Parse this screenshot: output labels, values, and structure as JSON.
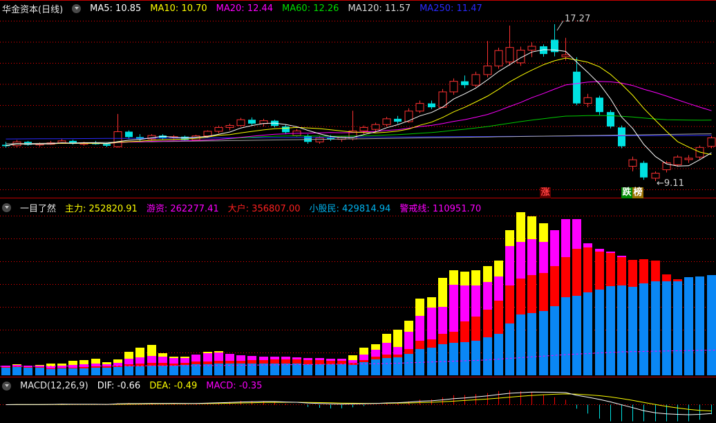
{
  "header": {
    "title": "华金资本(日线)",
    "ma_items": [
      {
        "name": "ma5-value",
        "label": "MA5:",
        "value": "10.85",
        "color": "#ffffff"
      },
      {
        "name": "ma10-value",
        "label": "MA10:",
        "value": "10.70",
        "color": "#ffff00"
      },
      {
        "name": "ma20-value",
        "label": "MA20:",
        "value": "12.44",
        "color": "#ff00ff"
      },
      {
        "name": "ma60-value",
        "label": "MA60:",
        "value": "12.26",
        "color": "#00dd00"
      },
      {
        "name": "ma120-value",
        "label": "MA120:",
        "value": "11.57",
        "color": "#d8d8d8"
      },
      {
        "name": "ma250-value",
        "label": "MA250:",
        "value": "11.47",
        "color": "#2a2aff"
      }
    ]
  },
  "middle_header": {
    "indicator": "一目了然",
    "items": [
      {
        "name": "zhuli-value",
        "label": "主力:",
        "value": "252820.91",
        "color": "#ffff00"
      },
      {
        "name": "youzi-value",
        "label": "游资:",
        "value": "262277.41",
        "color": "#ff00ff"
      },
      {
        "name": "dahu-value",
        "label": "大户:",
        "value": "356807.00",
        "color": "#ff2020"
      },
      {
        "name": "xiaogumin-value",
        "label": "小股民:",
        "value": "429814.94",
        "color": "#00b4f0"
      },
      {
        "name": "jingjiexian-value",
        "label": "警戒线:",
        "value": "110951.70",
        "color": "#ff00ff"
      }
    ]
  },
  "macd_header": {
    "indicator": "MACD(12,26,9)",
    "items": [
      {
        "name": "dif-value",
        "label": "DIF:",
        "value": "-0.66",
        "color": "#ffffff"
      },
      {
        "name": "dea-value",
        "label": "DEA:",
        "value": "-0.49",
        "color": "#ffff00"
      },
      {
        "name": "macd-value",
        "label": "MACD:",
        "value": "-0.35",
        "color": "#ff00ff"
      }
    ]
  },
  "annotations": {
    "high": "17.27",
    "low": "9.11",
    "zhang": "涨",
    "die": "跌",
    "bang": "榜"
  },
  "chart_data": [
    {
      "type": "candlestick",
      "title": "华金资本 日线",
      "ylim": [
        9.11,
        17.27
      ],
      "legend": [
        "MA5",
        "MA10",
        "MA20",
        "MA60",
        "MA120",
        "MA250"
      ],
      "ma_last": {
        "MA5": 10.85,
        "MA10": 10.7,
        "MA20": 12.44,
        "MA60": 12.26,
        "MA120": 11.57,
        "MA250": 11.47
      },
      "up_color": "#ff3232",
      "down_color": "#00e2e2",
      "grid": "red-dotted",
      "ohlc": [
        [
          11.0,
          11.15,
          10.85,
          10.95
        ],
        [
          10.95,
          11.25,
          10.88,
          11.15
        ],
        [
          11.15,
          11.2,
          10.95,
          11.0
        ],
        [
          11.0,
          11.12,
          10.9,
          11.06
        ],
        [
          11.06,
          11.2,
          11.0,
          11.1
        ],
        [
          11.1,
          11.3,
          11.05,
          11.2
        ],
        [
          11.2,
          11.26,
          11.0,
          11.05
        ],
        [
          11.05,
          11.16,
          10.95,
          11.1
        ],
        [
          11.1,
          11.2,
          11.0,
          11.04
        ],
        [
          11.04,
          11.1,
          10.88,
          10.95
        ],
        [
          10.9,
          12.6,
          10.85,
          11.68
        ],
        [
          11.68,
          11.75,
          11.3,
          11.4
        ],
        [
          11.4,
          11.55,
          11.2,
          11.3
        ],
        [
          11.3,
          11.55,
          11.25,
          11.48
        ],
        [
          11.48,
          11.55,
          11.28,
          11.35
        ],
        [
          11.35,
          11.5,
          11.25,
          11.42
        ],
        [
          11.42,
          11.48,
          11.18,
          11.25
        ],
        [
          11.25,
          11.52,
          11.2,
          11.46
        ],
        [
          11.46,
          11.75,
          11.35,
          11.7
        ],
        [
          11.7,
          12.0,
          11.6,
          11.9
        ],
        [
          11.9,
          12.1,
          11.75,
          12.0
        ],
        [
          12.0,
          12.4,
          11.95,
          12.3
        ],
        [
          12.3,
          12.42,
          12.02,
          12.1
        ],
        [
          12.1,
          12.35,
          11.95,
          12.25
        ],
        [
          12.25,
          12.3,
          11.9,
          11.98
        ],
        [
          11.95,
          12.05,
          11.55,
          11.65
        ],
        [
          11.48,
          11.82,
          11.42,
          11.72
        ],
        [
          11.45,
          11.55,
          11.05,
          11.15
        ],
        [
          11.15,
          11.45,
          11.05,
          11.35
        ],
        [
          11.35,
          11.5,
          11.2,
          11.28
        ],
        [
          11.28,
          11.45,
          11.15,
          11.4
        ],
        [
          11.3,
          12.77,
          11.22,
          11.72
        ],
        [
          11.72,
          12.0,
          11.55,
          11.9
        ],
        [
          11.8,
          12.15,
          11.7,
          12.05
        ],
        [
          12.05,
          12.45,
          11.95,
          12.35
        ],
        [
          12.35,
          12.5,
          12.1,
          12.2
        ],
        [
          12.2,
          12.9,
          12.15,
          12.75
        ],
        [
          12.75,
          13.3,
          12.65,
          13.15
        ],
        [
          13.15,
          13.3,
          12.85,
          12.95
        ],
        [
          12.95,
          13.9,
          12.9,
          13.75
        ],
        [
          13.75,
          14.45,
          13.6,
          14.3
        ],
        [
          14.3,
          14.6,
          13.95,
          14.1
        ],
        [
          14.1,
          14.8,
          14.0,
          14.65
        ],
        [
          14.65,
          16.4,
          14.5,
          15.1
        ],
        [
          15.1,
          16.05,
          14.95,
          15.9
        ],
        [
          15.3,
          17.2,
          15.12,
          16.06
        ],
        [
          15.26,
          16.1,
          15.1,
          15.92
        ],
        [
          15.92,
          16.32,
          15.56,
          16.12
        ],
        [
          16.12,
          16.22,
          15.58,
          15.72
        ],
        [
          16.46,
          17.27,
          15.6,
          15.82
        ],
        [
          15.58,
          16.56,
          15.38,
          15.68
        ],
        [
          14.8,
          15.55,
          13.05,
          13.15
        ],
        [
          13.15,
          13.65,
          12.95,
          13.45
        ],
        [
          13.45,
          13.55,
          12.55,
          12.7
        ],
        [
          12.7,
          12.8,
          11.85,
          11.95
        ],
        [
          11.9,
          12.0,
          10.82,
          10.92
        ],
        [
          9.88,
          10.38,
          9.62,
          10.22
        ],
        [
          10.06,
          10.16,
          9.18,
          9.3
        ],
        [
          9.26,
          9.62,
          9.11,
          9.52
        ],
        [
          9.7,
          10.16,
          9.56,
          10.06
        ],
        [
          9.96,
          10.46,
          9.86,
          10.36
        ],
        [
          10.26,
          10.46,
          10.06,
          10.3
        ],
        [
          10.36,
          10.96,
          10.26,
          10.86
        ],
        [
          10.92,
          11.46,
          10.82,
          11.36
        ]
      ]
    },
    {
      "type": "bar",
      "stacked": true,
      "name": "一目了然",
      "ylim": [
        0,
        760000
      ],
      "threshold_line": {
        "name": "警戒线",
        "value": 110951.7,
        "color": "#ff00ff"
      },
      "series": [
        {
          "name": "小股民",
          "color": "#0a87f5",
          "values": [
            33000,
            36000,
            33000,
            33000,
            27000,
            30000,
            30000,
            30000,
            33000,
            33000,
            36000,
            39000,
            39000,
            42000,
            42000,
            42000,
            45000,
            48000,
            48000,
            51000,
            51000,
            51000,
            51000,
            51000,
            51000,
            51000,
            51000,
            48000,
            48000,
            48000,
            48000,
            45000,
            57000,
            69000,
            75000,
            78000,
            93000,
            114000,
            120000,
            135000,
            141000,
            144000,
            150000,
            165000,
            180000,
            225000,
            264000,
            270000,
            279000,
            300000,
            339000,
            345000,
            360000,
            372000,
            387000,
            390000,
            384000,
            399000,
            408000,
            408000,
            408000,
            426000,
            429000,
            435000
          ]
        },
        {
          "name": "大户",
          "color": "#ff0000",
          "values": [
            3000,
            3000,
            3000,
            3000,
            3000,
            3000,
            3000,
            6000,
            6000,
            6000,
            6000,
            9000,
            12000,
            12000,
            12000,
            9000,
            9000,
            12000,
            12000,
            12000,
            12000,
            12000,
            15000,
            15000,
            18000,
            18000,
            18000,
            18000,
            18000,
            15000,
            15000,
            9000,
            9000,
            12000,
            15000,
            12000,
            21000,
            36000,
            36000,
            45000,
            48000,
            90000,
            105000,
            120000,
            144000,
            165000,
            156000,
            165000,
            165000,
            174000,
            174000,
            204000,
            195000,
            165000,
            144000,
            123000,
            117000,
            105000,
            90000,
            30000,
            9000,
            0,
            0,
            0
          ]
        },
        {
          "name": "游资",
          "color": "#ff00ff",
          "values": [
            6000,
            6000,
            6000,
            6000,
            9000,
            9000,
            12000,
            12000,
            12000,
            9000,
            12000,
            24000,
            27000,
            30000,
            27000,
            24000,
            21000,
            30000,
            36000,
            36000,
            30000,
            24000,
            18000,
            15000,
            12000,
            12000,
            9000,
            9000,
            9000,
            9000,
            9000,
            12000,
            24000,
            30000,
            51000,
            33000,
            75000,
            108000,
            138000,
            117000,
            204000,
            156000,
            135000,
            120000,
            105000,
            171000,
            159000,
            156000,
            135000,
            156000,
            165000,
            129000,
            18000,
            12000,
            6000,
            6000,
            0,
            0,
            0,
            0,
            0,
            0,
            0,
            0
          ]
        },
        {
          "name": "主力",
          "color": "#ffff00",
          "values": [
            0,
            3000,
            0,
            3000,
            12000,
            9000,
            18000,
            18000,
            21000,
            9000,
            15000,
            30000,
            42000,
            48000,
            15000,
            6000,
            6000,
            0,
            6000,
            6000,
            0,
            0,
            0,
            0,
            0,
            0,
            0,
            0,
            0,
            0,
            0,
            21000,
            30000,
            24000,
            39000,
            75000,
            48000,
            75000,
            45000,
            126000,
            63000,
            60000,
            66000,
            69000,
            69000,
            69000,
            129000,
            99000,
            81000,
            0,
            0,
            0,
            0,
            0,
            0,
            0,
            0,
            0,
            0,
            0,
            0,
            0,
            0,
            0,
            0
          ]
        }
      ]
    },
    {
      "type": "line",
      "name": "MACD(12,26,9)",
      "dif": -0.66,
      "dea": -0.49,
      "macd": -0.35,
      "colors": {
        "dif": "#ffffff",
        "dea": "#ffff00",
        "hist_up": "#ff0000",
        "hist_down": "#00e2e2"
      }
    }
  ]
}
